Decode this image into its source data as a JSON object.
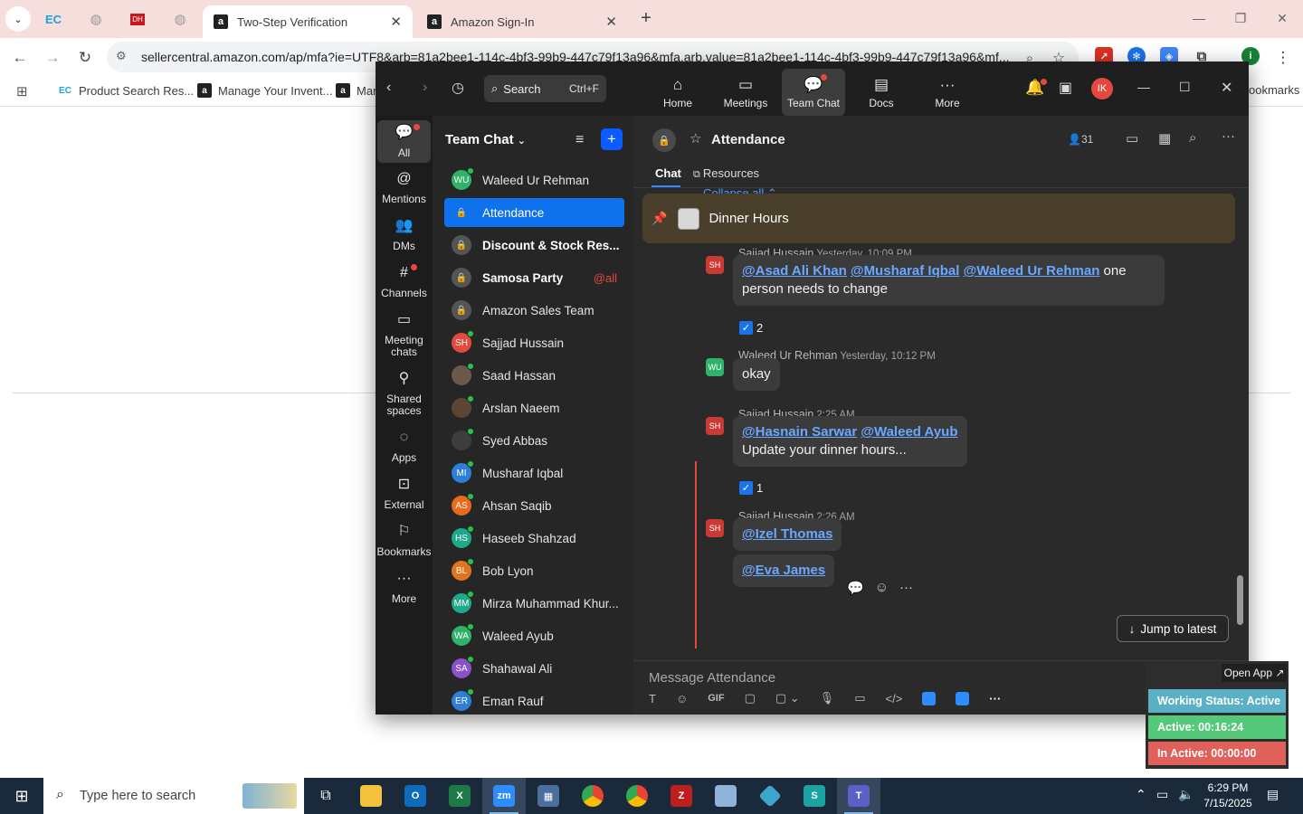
{
  "browser": {
    "tabs": [
      {
        "title": "Two-Step Verification",
        "favicon": "a",
        "active": true
      },
      {
        "title": "Amazon Sign-In",
        "favicon": "a",
        "active": false
      }
    ],
    "url": "sellercentral.amazon.com/ap/mfa?ie=UTF8&arb=81a2bee1-114c-4bf3-99b9-447c79f13a96&mfa.arb.value=81a2bee1-114c-4bf3-99b9-447c79f13a96&mf...",
    "bookmarks": [
      {
        "label": "Product Search Res...",
        "icon": "ec"
      },
      {
        "label": "Manage Your Invent...",
        "icon": "a"
      },
      {
        "label": "Mar",
        "icon": "a"
      }
    ],
    "bookmarks_overflow": "ookmarks"
  },
  "zoom": {
    "search": {
      "label": "Search",
      "shortcut": "Ctrl+F"
    },
    "nav": [
      {
        "label": "Home",
        "icon": "home-icon"
      },
      {
        "label": "Meetings",
        "icon": "camera-icon"
      },
      {
        "label": "Team Chat",
        "icon": "chat-icon"
      },
      {
        "label": "Docs",
        "icon": "doc-icon"
      },
      {
        "label": "More",
        "icon": "more-icon"
      }
    ],
    "user_initials": "IK",
    "rail": [
      {
        "label": "All",
        "icon": "chat-bubble-icon"
      },
      {
        "label": "Mentions",
        "icon": "at-icon"
      },
      {
        "label": "DMs",
        "icon": "people-icon"
      },
      {
        "label": "Channels",
        "icon": "hash-icon"
      },
      {
        "label": "Meeting chats",
        "icon": "calendar-icon"
      },
      {
        "label": "Shared spaces",
        "icon": "share-icon"
      },
      {
        "label": "Apps",
        "icon": "apps-icon"
      },
      {
        "label": "External",
        "icon": "external-icon"
      },
      {
        "label": "Bookmarks",
        "icon": "bookmark-icon"
      },
      {
        "label": "More",
        "icon": "more-icon"
      }
    ],
    "channel_list": {
      "title": "Team Chat",
      "items": [
        {
          "name": "Waleed Ur Rehman",
          "type": "dm",
          "initials": "WU",
          "color": "#2fb36a"
        },
        {
          "name": "Attendance",
          "type": "channel",
          "active": true
        },
        {
          "name": "Discount & Stock Res...",
          "type": "channel",
          "bold": true
        },
        {
          "name": "Samosa Party",
          "type": "channel",
          "bold": true,
          "badge": "@all"
        },
        {
          "name": "Amazon Sales Team",
          "type": "channel"
        },
        {
          "name": "Sajjad Hussain",
          "type": "dm",
          "initials": "SH",
          "color": "#e5483f"
        },
        {
          "name": "Saad Hassan",
          "type": "dm",
          "initials": "",
          "color": "#6b5a4a"
        },
        {
          "name": "Arslan Naeem",
          "type": "dm",
          "initials": "",
          "color": "#5b4636"
        },
        {
          "name": "Syed Abbas",
          "type": "dm",
          "initials": "",
          "color": "#3d3d3d"
        },
        {
          "name": "Musharaf Iqbal",
          "type": "dm",
          "initials": "MI",
          "color": "#2d7fd8"
        },
        {
          "name": "Ahsan Saqib",
          "type": "dm",
          "initials": "AS",
          "color": "#e86a1c"
        },
        {
          "name": "Haseeb Shahzad",
          "type": "dm",
          "initials": "HS",
          "color": "#1fa88a"
        },
        {
          "name": "Bob Lyon",
          "type": "dm",
          "initials": "BL",
          "color": "#e0751e"
        },
        {
          "name": "Mirza Muhammad Khur...",
          "type": "dm",
          "initials": "MM",
          "color": "#1fa88a"
        },
        {
          "name": "Waleed Ayub",
          "type": "dm",
          "initials": "WA",
          "color": "#2fb36a"
        },
        {
          "name": "Shahawal Ali",
          "type": "dm",
          "initials": "SA",
          "color": "#8a52c8"
        },
        {
          "name": "Eman Rauf",
          "type": "dm",
          "initials": "ER",
          "color": "#2d7fd8"
        }
      ]
    },
    "chat": {
      "title": "Attendance",
      "member_count": "31",
      "tabs": [
        "Chat",
        "Resources"
      ],
      "collapse_label": "Collapse all",
      "pinned": "Dinner Hours",
      "messages": [
        {
          "sender": "Sajjad Hussain",
          "time": "Yesterday, 10:09 PM",
          "initials": "SH",
          "mentions": [
            "@Asad Ali Khan",
            "@Musharaf Iqbal",
            "@Waleed Ur Rehman"
          ],
          "text_a": "one",
          "text_b": "person needs to change",
          "reaction_count": "2"
        },
        {
          "sender": "Waleed Ur Rehman",
          "time": "Yesterday, 10:12 PM",
          "initials": "WU",
          "text": "okay"
        },
        {
          "sender": "Sajjad Hussain",
          "time": "2:25 AM",
          "initials": "SH",
          "mentions": [
            "@Hasnain Sarwar",
            "@Waleed Ayub"
          ],
          "text": "Update your dinner hours...",
          "reaction_count": "1"
        },
        {
          "sender": "Sajjad Hussain",
          "time": "2:26 AM",
          "initials": "SH",
          "mentions": [
            "@Izel Thomas"
          ],
          "mention_2": "@Eva James"
        }
      ],
      "jump_label": "Jump to latest",
      "composer_placeholder": "Message Attendance",
      "composer_tools": [
        "T",
        "☺",
        "GIF",
        "▢",
        "▢",
        "⌄",
        "🎤",
        "▭",
        "</>",
        "",
        "",
        "···"
      ]
    }
  },
  "work_status": {
    "open_app": "Open App ↗",
    "status": "Working Status: Active",
    "active": "Active: 00:16:24",
    "inactive": "In Active: 00:00:00",
    "colors": {
      "status": "#5ab0c4",
      "active": "#55c97a",
      "inactive": "#e0615a"
    }
  },
  "taskbar": {
    "search_placeholder": "Type here to search",
    "time": "6:29 PM",
    "date": "7/15/2025"
  }
}
